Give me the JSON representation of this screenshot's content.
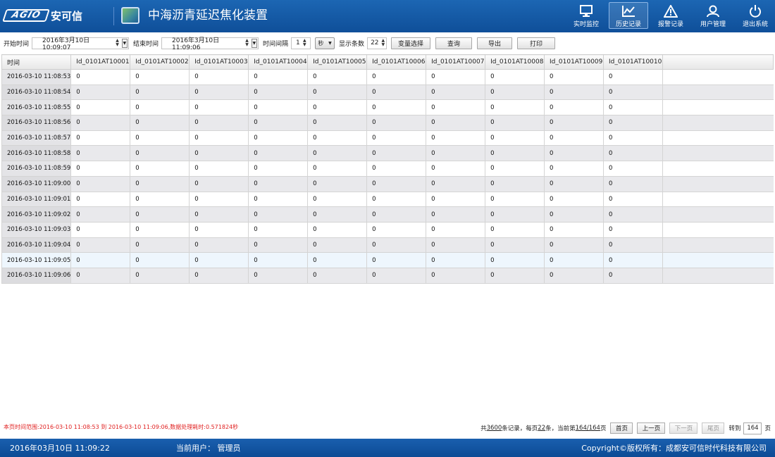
{
  "header": {
    "logo_mark": "AGIO",
    "logo_text": "安可信",
    "app_title": "中海沥青延迟焦化装置",
    "nav": [
      {
        "label": "实时监控",
        "icon": "monitor-icon"
      },
      {
        "label": "历史记录",
        "icon": "chart-icon",
        "active": true
      },
      {
        "label": "报警记录",
        "icon": "warning-icon"
      },
      {
        "label": "用户管理",
        "icon": "user-icon"
      },
      {
        "label": "退出系统",
        "icon": "power-icon"
      }
    ]
  },
  "toolbar": {
    "start_label": "开始时间",
    "start_value": "2016年3月10日 10:09:07",
    "end_label": "结束时间",
    "end_value": "2016年3月10日 11:09:06",
    "interval_label": "时间间隔",
    "interval_value": "1",
    "interval_unit": "秒",
    "count_label": "显示条数",
    "count_value": "22",
    "var_select": "变量选择",
    "query": "查询",
    "export": "导出",
    "print": "打印"
  },
  "table": {
    "time_header": "时间",
    "columns": [
      "Id_0101AT10001",
      "Id_0101AT10002",
      "Id_0101AT10003",
      "Id_0101AT10004",
      "Id_0101AT10005",
      "Id_0101AT10006",
      "Id_0101AT10007",
      "Id_0101AT10008",
      "Id_0101AT10009",
      "Id_0101AT10010"
    ],
    "rows": [
      {
        "time": "2016-03-10 11:08:53",
        "values": [
          "0",
          "0",
          "0",
          "0",
          "0",
          "0",
          "0",
          "0",
          "0",
          "0"
        ]
      },
      {
        "time": "2016-03-10 11:08:54",
        "values": [
          "0",
          "0",
          "0",
          "0",
          "0",
          "0",
          "0",
          "0",
          "0",
          "0"
        ]
      },
      {
        "time": "2016-03-10 11:08:55",
        "values": [
          "0",
          "0",
          "0",
          "0",
          "0",
          "0",
          "0",
          "0",
          "0",
          "0"
        ]
      },
      {
        "time": "2016-03-10 11:08:56",
        "values": [
          "0",
          "0",
          "0",
          "0",
          "0",
          "0",
          "0",
          "0",
          "0",
          "0"
        ]
      },
      {
        "time": "2016-03-10 11:08:57",
        "values": [
          "0",
          "0",
          "0",
          "0",
          "0",
          "0",
          "0",
          "0",
          "0",
          "0"
        ]
      },
      {
        "time": "2016-03-10 11:08:58",
        "values": [
          "0",
          "0",
          "0",
          "0",
          "0",
          "0",
          "0",
          "0",
          "0",
          "0"
        ]
      },
      {
        "time": "2016-03-10 11:08:59",
        "values": [
          "0",
          "0",
          "0",
          "0",
          "0",
          "0",
          "0",
          "0",
          "0",
          "0"
        ]
      },
      {
        "time": "2016-03-10 11:09:00",
        "values": [
          "0",
          "0",
          "0",
          "0",
          "0",
          "0",
          "0",
          "0",
          "0",
          "0"
        ]
      },
      {
        "time": "2016-03-10 11:09:01",
        "values": [
          "0",
          "0",
          "0",
          "0",
          "0",
          "0",
          "0",
          "0",
          "0",
          "0"
        ]
      },
      {
        "time": "2016-03-10 11:09:02",
        "values": [
          "0",
          "0",
          "0",
          "0",
          "0",
          "0",
          "0",
          "0",
          "0",
          "0"
        ]
      },
      {
        "time": "2016-03-10 11:09:03",
        "values": [
          "0",
          "0",
          "0",
          "0",
          "0",
          "0",
          "0",
          "0",
          "0",
          "0"
        ]
      },
      {
        "time": "2016-03-10 11:09:04",
        "values": [
          "0",
          "0",
          "0",
          "0",
          "0",
          "0",
          "0",
          "0",
          "0",
          "0"
        ]
      },
      {
        "time": "2016-03-10 11:09:05",
        "values": [
          "0",
          "0",
          "0",
          "0",
          "0",
          "0",
          "0",
          "0",
          "0",
          "0"
        ]
      },
      {
        "time": "2016-03-10 11:09:06",
        "values": [
          "0",
          "0",
          "0",
          "0",
          "0",
          "0",
          "0",
          "0",
          "0",
          "0"
        ]
      }
    ]
  },
  "range_info": "本页时间范围:2016-03-10 11:08:53 到 2016-03-10 11:09:06,数据处理耗时:0.571824秒",
  "pager": {
    "total_prefix": "共",
    "total": "3600",
    "total_suffix": "条记录，每页",
    "per_page": "22",
    "per_page_suffix": "条，当前第",
    "current": "164/164",
    "current_suffix": "页",
    "first": "首页",
    "prev": "上一页",
    "next": "下一页",
    "last": "尾页",
    "goto_label": "转到",
    "goto_value": "164",
    "goto_suffix": "页"
  },
  "footer": {
    "datetime": "2016年03月10日 11:09:22",
    "user_label": "当前用户：",
    "user_name": "管理员",
    "copyright": "Copyright©版权所有：成都安可信时代科技有限公司"
  }
}
